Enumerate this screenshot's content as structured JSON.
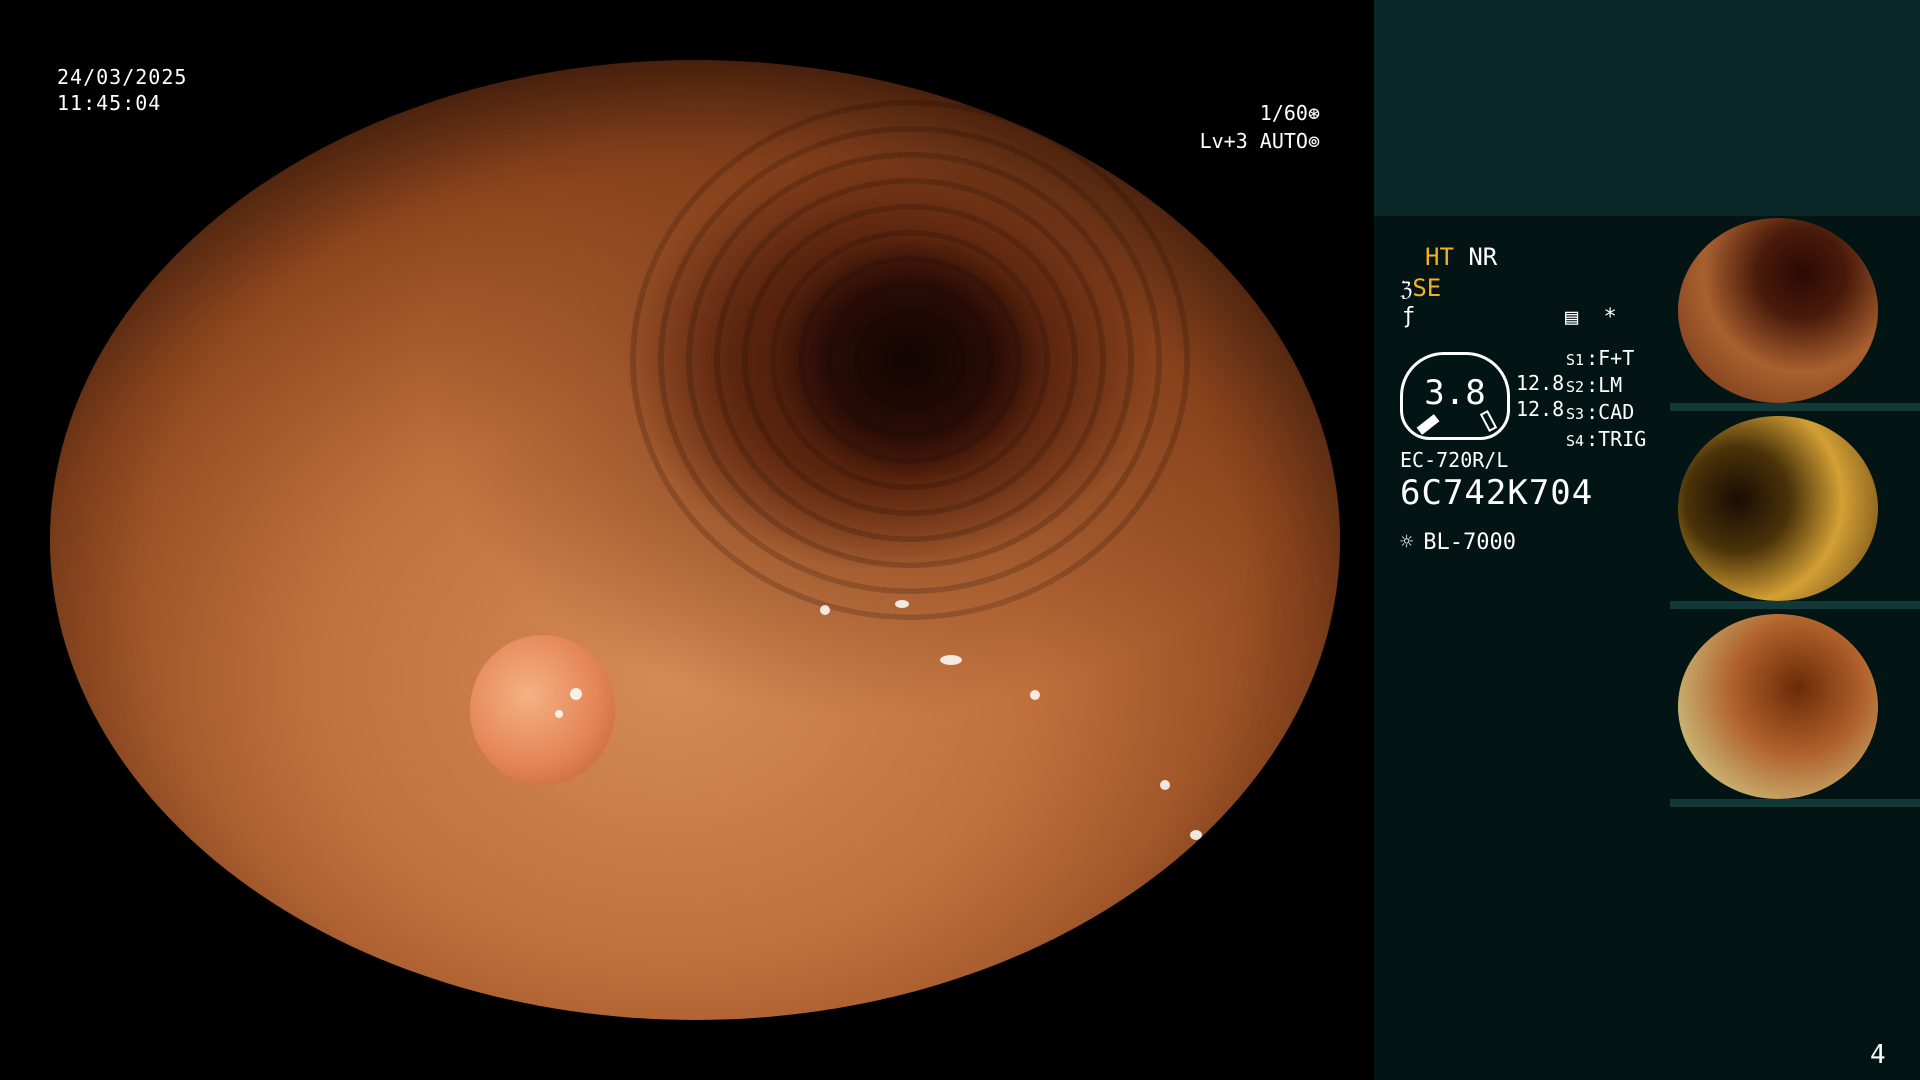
{
  "overlay": {
    "date": "24/03/2025",
    "time": "11:45:04",
    "shutter": "1/60",
    "shutter_icon": "shutter-icon",
    "exposure": "Lv+3 AUTO",
    "exposure_icon": "iris-icon"
  },
  "panel": {
    "modes": {
      "ht": "HT",
      "nr": "NR",
      "se": "SE",
      "se_icon": "structure-enhance-icon",
      "f_icon": "f-curve-icon",
      "record_icon": "record-icon",
      "star": "*"
    },
    "gauge": {
      "value": "3.8",
      "side_top": "12.8",
      "side_bottom": "12.8"
    },
    "presets": [
      {
        "key": "S1",
        "value": "F+T"
      },
      {
        "key": "S2",
        "value": "LM"
      },
      {
        "key": "S3",
        "value": "CAD"
      },
      {
        "key": "S4",
        "value": "TRIG"
      }
    ],
    "scope_model": "EC-720R/L",
    "serial": "6C742K704",
    "light_source": "BL-7000",
    "light_icon": "lamp-icon"
  },
  "thumbnails": [
    {
      "label": "thumbnail-1"
    },
    {
      "label": "thumbnail-2"
    },
    {
      "label": "thumbnail-3"
    }
  ],
  "page_number": "4",
  "colors": {
    "panel_top": "#0b2828",
    "panel": "#021414",
    "accent": "#f5b020"
  }
}
